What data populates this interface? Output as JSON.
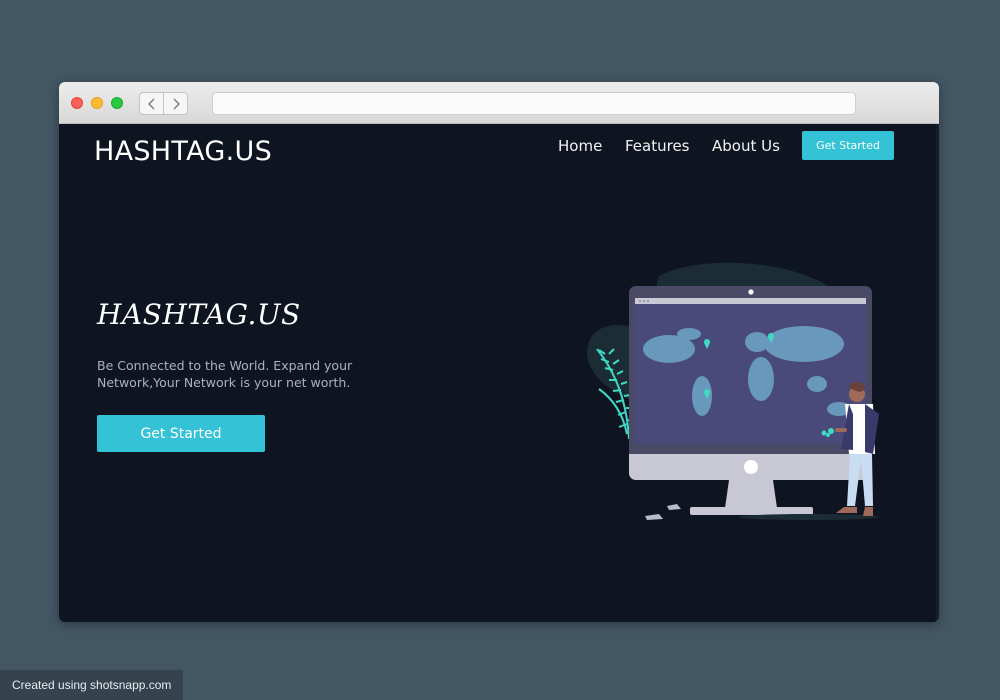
{
  "browser": {
    "icons": [
      "back-chevron-icon",
      "forward-chevron-icon"
    ]
  },
  "header": {
    "brand": "HASHTAG.US",
    "nav": [
      "Home",
      "Features",
      "About Us"
    ],
    "cta_label": "Get Started"
  },
  "hero": {
    "title": "HASHTAG.US",
    "text": "Be Connected to the World. Expand your Network,Your Network is your net worth.",
    "cta_label": "Get Started"
  },
  "illustration": {
    "icons": [
      "world-map-icon",
      "monitor-icon",
      "person-icon",
      "plant-icon",
      "location-pin-icon"
    ]
  },
  "colors": {
    "background": "#435663",
    "page_bg": "#0f1520",
    "accent": "#33c2d6",
    "screen": "#4a4a7a",
    "monitor_frame": "#4b4a66",
    "monitor_stand": "#c8c8d4"
  },
  "watermark": "Created using shotsnapp.com"
}
